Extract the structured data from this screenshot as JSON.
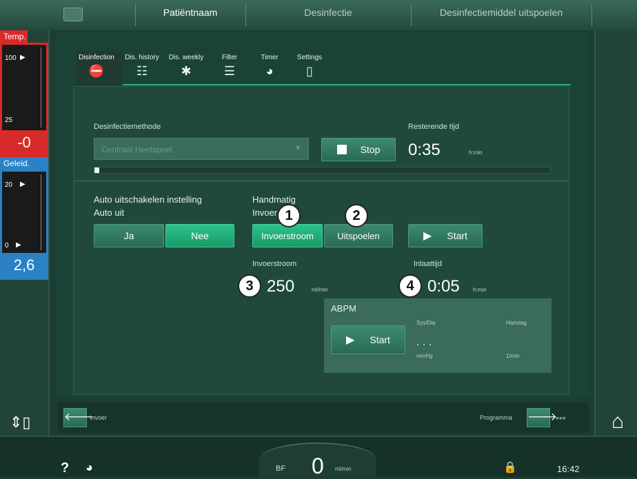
{
  "header": {
    "patient": "Patiëntnaam",
    "disinfection": "Desinfectie",
    "rinse": "Desinfectiemiddel uitspoelen"
  },
  "left": {
    "temp_label": "Temp.",
    "temp_max": "100",
    "temp_min": "25",
    "temp_value": "-0",
    "cond_label": "Geleid.",
    "cond_max": "20",
    "cond_min": "0",
    "cond_value": "2,6"
  },
  "tabs": [
    {
      "label": "Disinfection"
    },
    {
      "label": "Dis. history"
    },
    {
      "label": "Dis. weekly"
    },
    {
      "label": "Filter"
    },
    {
      "label": "Timer"
    },
    {
      "label": "Settings"
    }
  ],
  "method": {
    "label": "Desinfectiemethode",
    "value": "Centraal Heetspoel"
  },
  "stop_label": "Stop",
  "remaining": {
    "label": "Resterende tijd",
    "value": "0:35",
    "unit": "h:min"
  },
  "progress_fraction": 0.01,
  "auto_off": {
    "title": "Auto uitschakelen instelling",
    "label": "Auto uit",
    "yes": "Ja",
    "no": "Nee"
  },
  "manual": {
    "title": "Handmatig",
    "label": "Invoer",
    "intake": "Invoerstroom",
    "rinse": "Uitspoelen",
    "start": "Start"
  },
  "intake_flow": {
    "label": "Invoerstroom",
    "value": "250",
    "unit": "ml/min"
  },
  "intake_time": {
    "label": "Inlaattijd",
    "value": "0:05",
    "unit": "h:min"
  },
  "abpm": {
    "title": "ABPM",
    "start": "Start",
    "sysdia": "Sys/Dia",
    "pulse": "Hartslag",
    "value": ". . .",
    "unit_bp": "mmHg",
    "unit_pulse": "1/min"
  },
  "callouts": [
    "1",
    "2",
    "3",
    "4"
  ],
  "navbar": {
    "back": "Invoer",
    "forward": "Programma"
  },
  "bottom": {
    "help": "?",
    "bf": "BF",
    "flow": "0",
    "flow_unit": "ml/min",
    "time": "16:42"
  }
}
